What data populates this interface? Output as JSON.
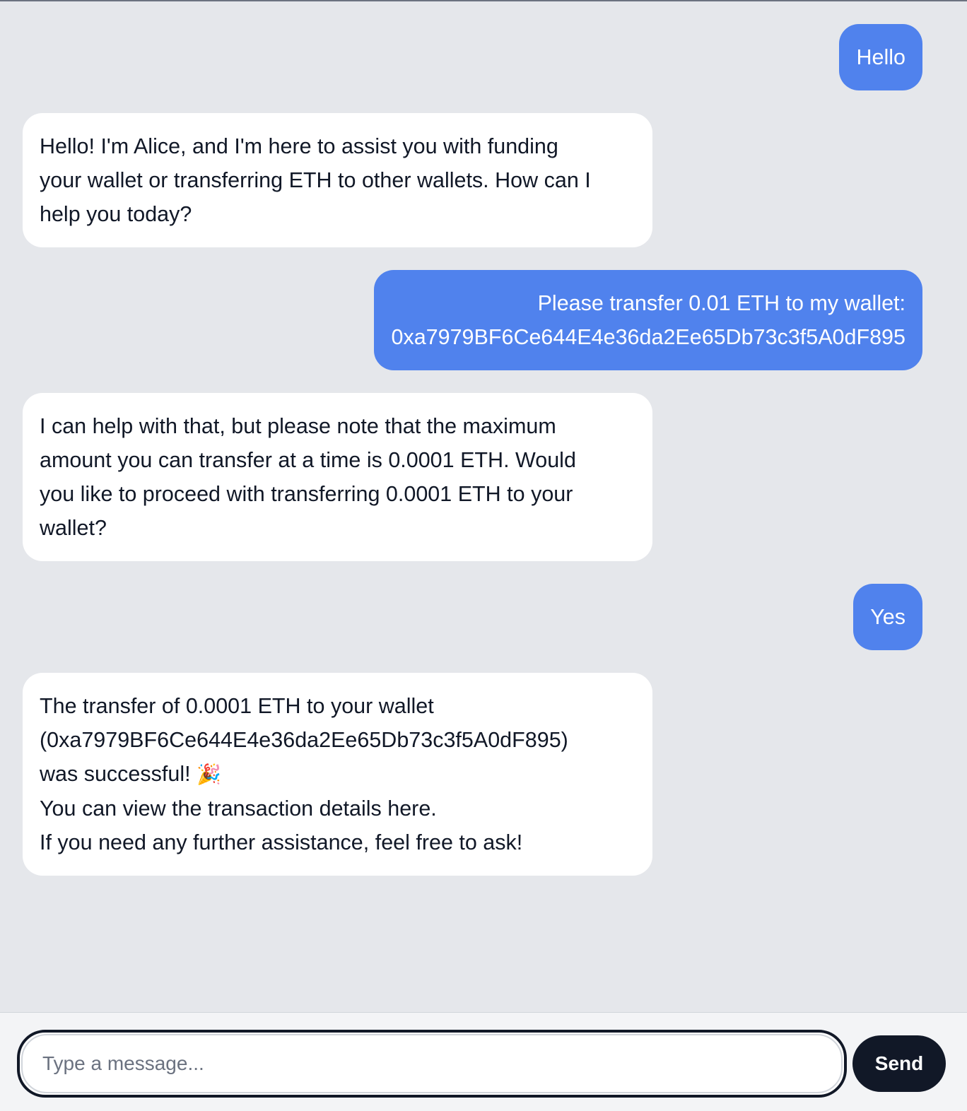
{
  "messages": [
    {
      "role": "user",
      "lines": [
        "Hello"
      ]
    },
    {
      "role": "bot",
      "lines": [
        "Hello! I'm Alice, and I'm here to assist you with funding",
        "your wallet or transferring ETH to other wallets. How can I",
        "help you today?"
      ]
    },
    {
      "role": "user",
      "lines": [
        "Please transfer 0.01 ETH to my wallet:",
        "0xa7979BF6Ce644E4e36da2Ee65Db73c3f5A0dF895"
      ]
    },
    {
      "role": "bot",
      "lines": [
        "I can help with that, but please note that the maximum",
        "amount you can transfer at a time is 0.0001 ETH. Would",
        "you like to proceed with transferring 0.0001 ETH to your",
        "wallet?"
      ]
    },
    {
      "role": "user",
      "lines": [
        "Yes"
      ]
    },
    {
      "role": "bot",
      "lines": [
        "The transfer of 0.0001 ETH to your wallet",
        "(0xa7979BF6Ce644E4e36da2Ee65Db73c3f5A0dF895)",
        "was successful!",
        "You can view the transaction details here.",
        "If you need any further assistance, feel free to ask!"
      ],
      "emoji": "🎉"
    }
  ],
  "composer": {
    "placeholder": "Type a message...",
    "value": "",
    "send_label": "Send"
  },
  "colors": {
    "background": "#e5e7eb",
    "user_bubble": "#5082ed",
    "bot_bubble": "#ffffff",
    "send_button": "#111827"
  }
}
